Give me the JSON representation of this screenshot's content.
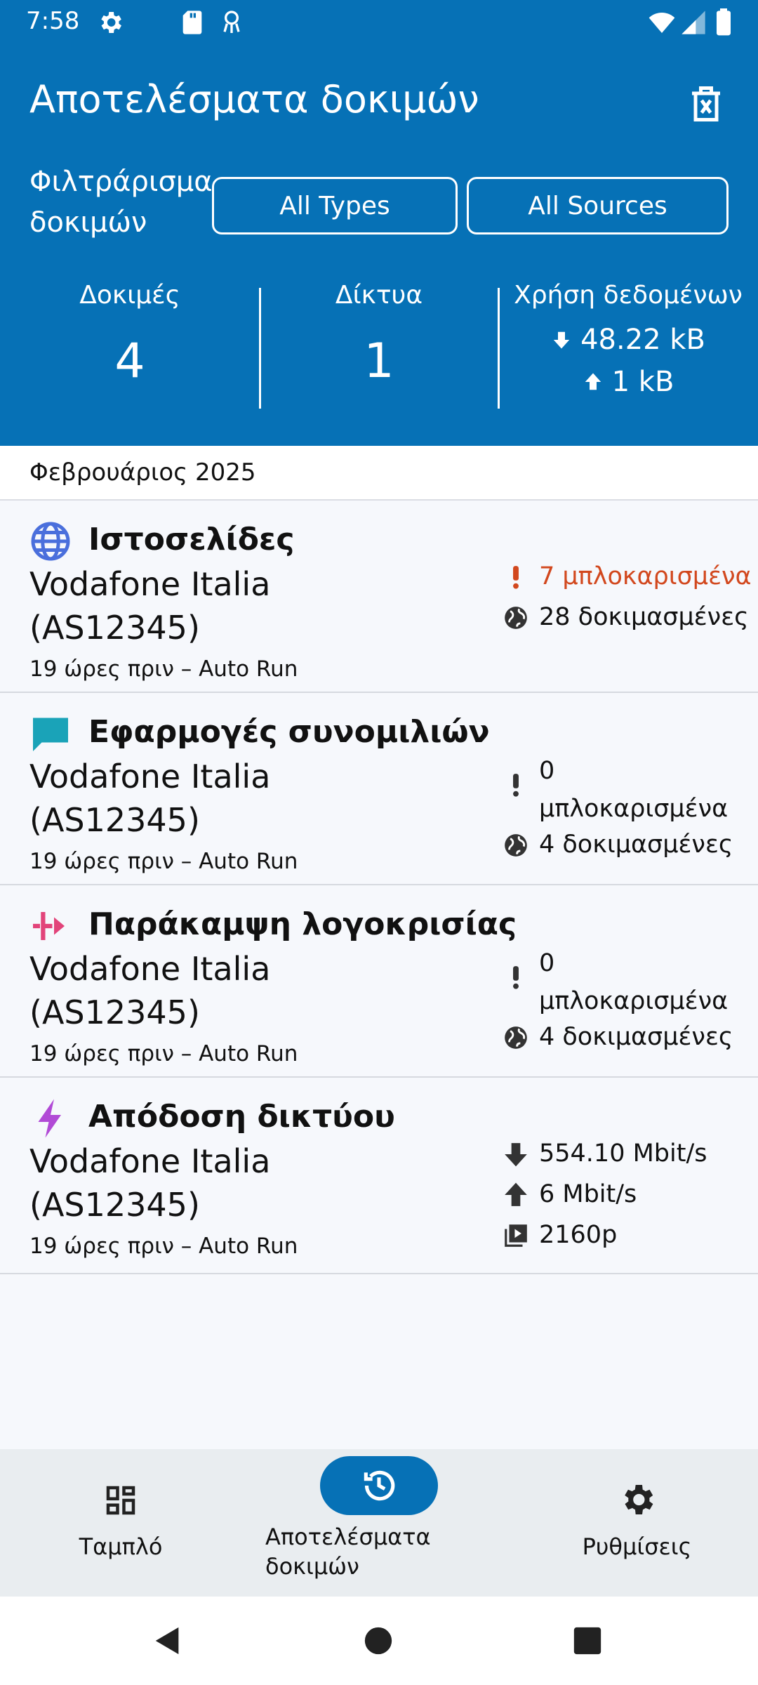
{
  "status_bar": {
    "time": "7:58"
  },
  "header": {
    "title": "Αποτελέσματα δοκιμών",
    "filter_label": "Φιλτράρισμα δοκιμών",
    "filter_types": "All Types",
    "filter_sources": "All Sources"
  },
  "stats": {
    "tests_label": "Δοκιμές",
    "tests_value": "4",
    "networks_label": "Δίκτυα",
    "networks_value": "1",
    "usage_label": "Χρήση δεδομένων",
    "download": "48.22 kB",
    "upload": "1 kB"
  },
  "month": "Φεβρουάριος 2025",
  "cards": [
    {
      "title": "Ιστοσελίδες",
      "network": "Vodafone Italia (AS12345)",
      "time": "19 ώρες πριν – Auto Run",
      "blocked": "7 μπλοκαρισμένα",
      "tested": "28 δοκιμασμένες"
    },
    {
      "title": "Εφαρμογές συνομιλιών",
      "network": "Vodafone Italia (AS12345)",
      "time": "19 ώρες πριν – Auto Run",
      "blocked": "0 μπλοκαρισμένα",
      "tested": "4 δοκιμασμένες"
    },
    {
      "title": "Παράκαμψη λογοκρισίας",
      "network": "Vodafone Italia (AS12345)",
      "time": "19 ώρες πριν – Auto Run",
      "blocked": "0 μπλοκαρισμένα",
      "tested": "4 δοκιμασμένες"
    },
    {
      "title": "Απόδοση δικτύου",
      "network": "Vodafone Italia (AS12345)",
      "time": "19 ώρες πριν – Auto Run",
      "download": "554.10 Mbit/s",
      "upload": "6 Mbit/s",
      "video": "2160p"
    }
  ],
  "nav": {
    "dashboard": "Ταμπλό",
    "results": "Αποτελέσματα δοκιμών",
    "settings": "Ρυθμίσεις"
  },
  "colors": {
    "primary": "#0671b6",
    "blocked_red": "#d2481e",
    "websites_icon": "#4a6fdc",
    "chat_icon": "#1aa3b8",
    "circumvention_icon": "#e2447a",
    "performance_icon": "#b14ad6"
  }
}
